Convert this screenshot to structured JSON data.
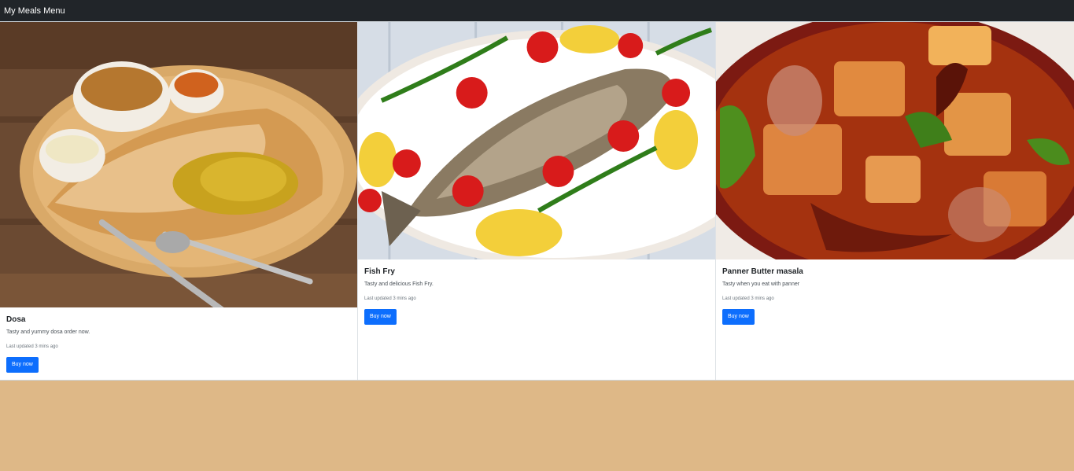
{
  "navbar": {
    "brand": "My Meals Menu"
  },
  "cards": [
    {
      "title": "Dosa",
      "text": "Tasty and yummy dosa order now.",
      "updated": "Last updated 3 mins ago",
      "button": "Buy now",
      "image": "dosa-photo"
    },
    {
      "title": "Fish Fry",
      "text": "Tasty and delicious Fish Fry.",
      "updated": "Last updated 3 mins ago",
      "button": "Buy now",
      "image": "fish-fry-photo"
    },
    {
      "title": "Panner Butter masala",
      "text": "Tasty when you eat with panner",
      "updated": "Last updated 3 mins ago",
      "button": "Buy now",
      "image": "panner-butter-masala-photo"
    }
  ],
  "colors": {
    "navbar_bg": "#212529",
    "page_bg": "#deb887",
    "button_bg": "#0d6efd"
  }
}
